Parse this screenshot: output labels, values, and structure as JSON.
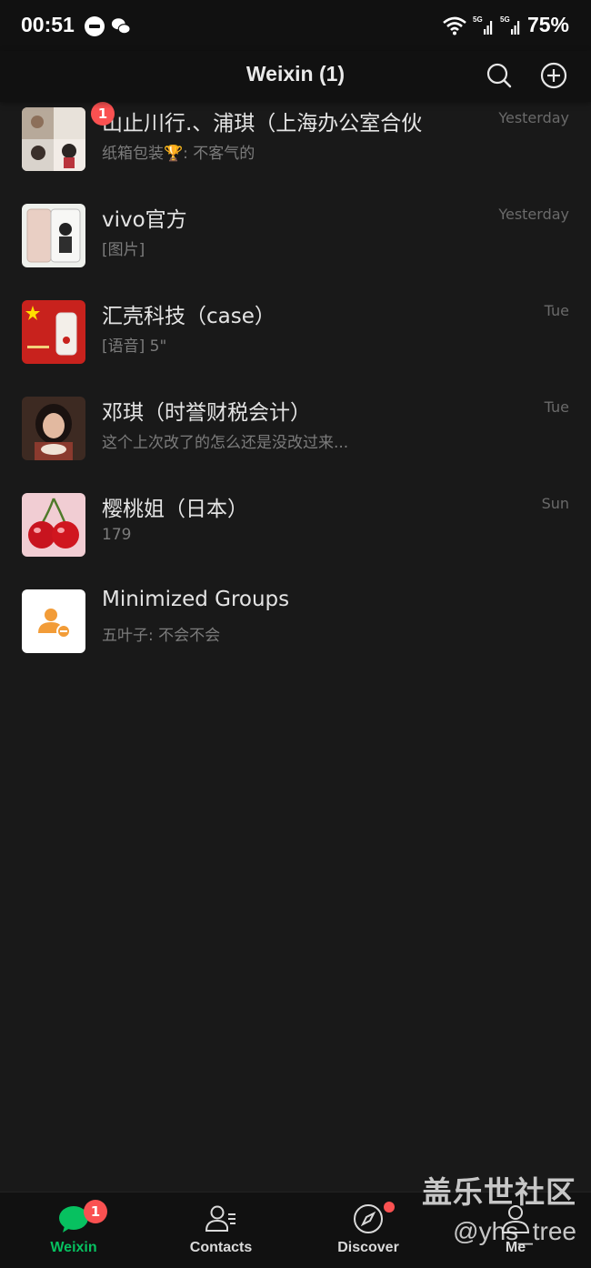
{
  "status_bar": {
    "time": "00:51",
    "battery": "75%",
    "signal1": "5G",
    "signal2": "5G"
  },
  "header": {
    "title": "Weixin (1)",
    "search_icon": "search-icon",
    "add_icon": "plus-circle-icon"
  },
  "chats": [
    {
      "name": "山止川行.、浦琪（上海办公室合伙",
      "preview": "纸箱包装🏆: 不客气的",
      "time": "Yesterday",
      "unread": "1"
    },
    {
      "name": "vivo官方",
      "preview": "[图片]",
      "time": "Yesterday"
    },
    {
      "name": "汇壳科技（case）",
      "preview": "[语音] 5\"",
      "time": "Tue"
    },
    {
      "name": "邓琪（时誉财税会计）",
      "preview": "这个上次改了的怎么还是没改过来...",
      "time": "Tue"
    },
    {
      "name": "樱桃姐（日本）",
      "preview": "179",
      "time": "Sun"
    },
    {
      "name": "Minimized Groups",
      "preview": "五叶子: 不会不会",
      "time": ""
    }
  ],
  "tabs": [
    {
      "label": "Weixin",
      "badge": "1",
      "icon": "chat-bubble-icon"
    },
    {
      "label": "Contacts",
      "icon": "contacts-icon"
    },
    {
      "label": "Discover",
      "icon": "compass-icon"
    },
    {
      "label": "Me",
      "icon": "person-icon"
    }
  ],
  "watermark": {
    "site": "盖乐世社区",
    "handle": "@yhs_tree"
  },
  "colors": {
    "accent": "#07c160",
    "badge": "#fa5151",
    "background": "#191919",
    "bar": "#111111"
  }
}
